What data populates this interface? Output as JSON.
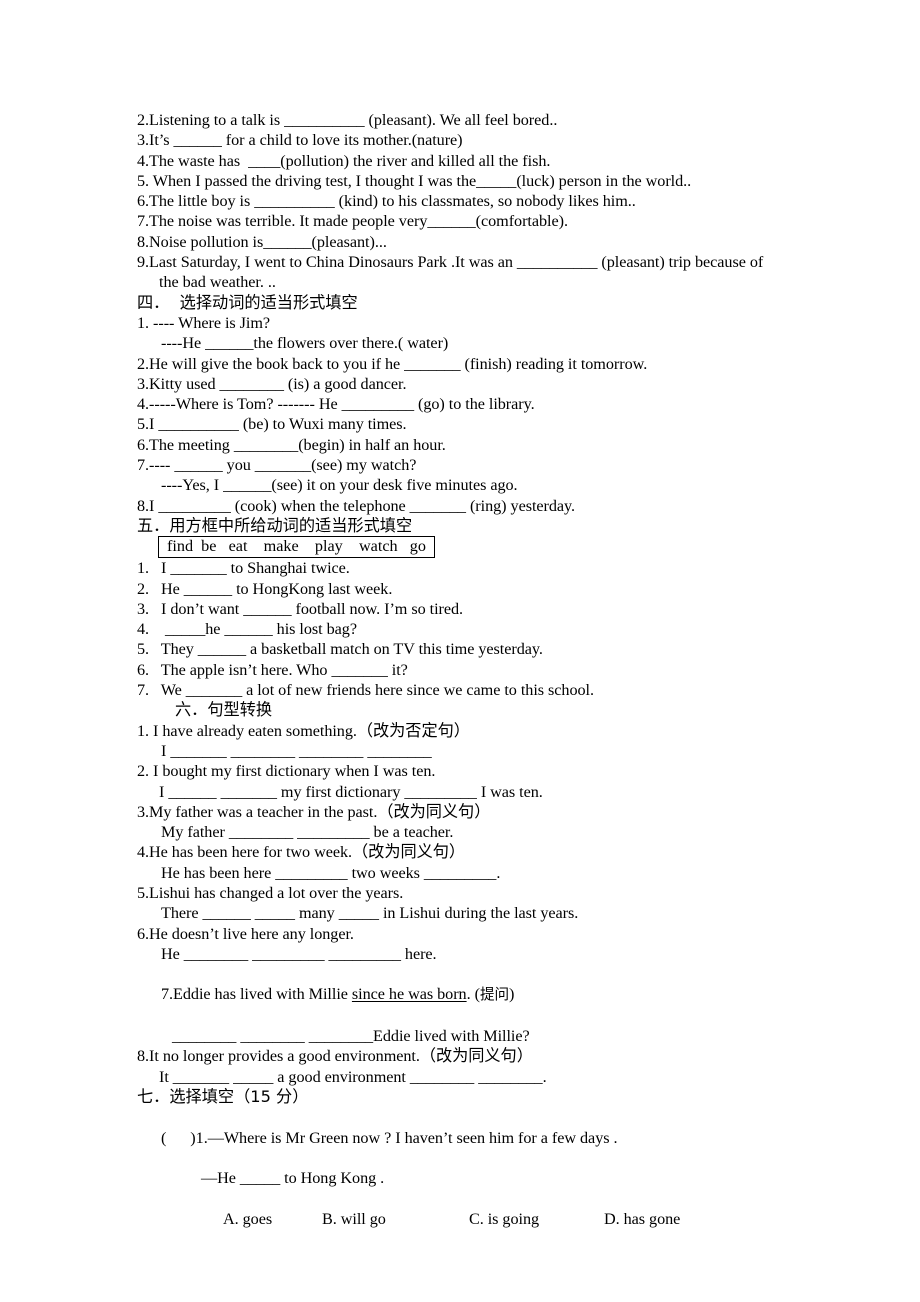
{
  "document": {
    "type": "english-grammar-worksheet",
    "page_background": "#ffffff",
    "text_color": "#000000"
  },
  "section_three_tail": {
    "items": [
      "2.Listening to a talk is __________ (pleasant). We all feel bored..",
      "3.It’s ______ for a child to love its mother.(nature)",
      "4.The waste has  ____(pollution) the river and killed all the fish.",
      "5. When I passed the driving test, I thought I was the_____(luck) person in the world..",
      "6.The little boy is __________ (kind) to his classmates, so nobody likes him..",
      "7.The noise was terrible. It made people very______(comfortable).",
      "8.Noise pollution is______(pleasant)...",
      "9.Last Saturday, I went to China Dinosaurs Park .It was an __________ (pleasant) trip because of",
      "the bad weather. .."
    ]
  },
  "section_four": {
    "heading": "四．  选择动词的适当形式填空",
    "items": [
      "1. ---- Where is Jim?",
      "----He ______the flowers over there.( water)",
      "2.He will give the book back to you if he _______ (finish) reading it tomorrow.",
      "3.Kitty used ________ (is) a good dancer.",
      "4.-----Where is Tom? ------- He _________ (go) to the library.",
      "5.I __________ (be) to Wuxi many times.",
      "6.The meeting ________(begin) in half an hour.",
      "7.---- ______ you _______(see) my watch?",
      "----Yes, I ______(see) it on your desk five minutes ago.",
      "8.I _________ (cook) when the telephone _______ (ring) yesterday."
    ]
  },
  "section_five": {
    "heading": "五．用方框中所给动词的适当形式填空",
    "word_box": "find  be   eat    make    play    watch   go",
    "words": [
      "find",
      "be",
      "eat",
      "make",
      "play",
      "watch",
      "go"
    ],
    "items": [
      "1.   I _______ to Shanghai twice.",
      "2.   He ______ to HongKong last week.",
      "3.   I don’t want ______ football now. I’m so tired.",
      "4.    _____he ______ his lost bag?",
      "5.   They ______ a basketball match on TV this time yesterday.",
      "6.   The apple isn’t here. Who _______ it?",
      "7.   We _______ a lot of new friends here since we came to this school."
    ]
  },
  "section_six": {
    "heading": "六．句型转换",
    "items": [
      "1. I have already eaten something.（改为否定句）",
      "I _______ ________ ________ ________",
      "2. I bought my first dictionary when I was ten.",
      "I ______ _______ my first dictionary _________ I was ten.",
      "3.My father was a teacher in the past.（改为同义句）",
      "My father ________ _________ be a teacher.",
      "4.He has been here for two week.（改为同义句）",
      "He has been here _________ two weeks _________.",
      "5.Lishui has changed a lot over the years.",
      "There ______ _____ many _____ in Lishui during the last years.",
      "6.He doesn’t live here any longer.",
      "He ________ _________ _________ here.",
      "7.Eddie has lived with Millie since he was born. (提问)",
      "________ ________ ________Eddie lived with Millie?",
      "8.It no longer provides a good environment.（改为同义句）",
      "It _______ _____ a good environment ________ ________."
    ],
    "underlined_phrase": "since he was born"
  },
  "section_seven": {
    "heading": "七．选择填空（15 分）",
    "question_1": {
      "bracket": "(      )1.",
      "stem_line_1": "—Where is Mr Green now ? I haven’t seen him for a few days .",
      "stem_line_2": "—He _____ to Hong Kong .",
      "options": [
        "A. goes",
        "B. will go",
        "C. is going",
        "D. has gone"
      ]
    }
  }
}
